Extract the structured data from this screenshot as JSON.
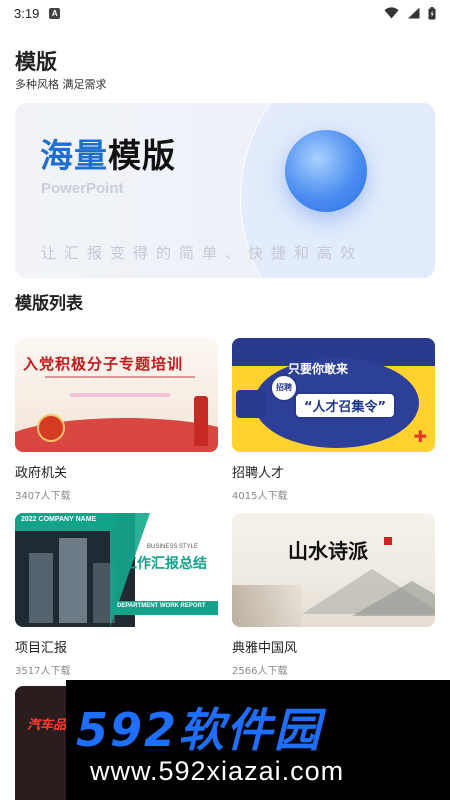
{
  "status_bar": {
    "time": "3:19",
    "notification_icon": "A"
  },
  "header": {
    "title": "模版",
    "subtitle": "多种风格 满足需求"
  },
  "banner": {
    "headline_highlight": "海量",
    "headline_rest": "模版",
    "subtitle_en": "PowerPoint",
    "slogan": "让汇报变得的简单、快捷和高效"
  },
  "section": {
    "title": "模版列表"
  },
  "templates": [
    {
      "name": "政府机关",
      "downloads": "3407人下载",
      "thumb_title": "入党积极分子专题培训"
    },
    {
      "name": "招聘人才",
      "downloads": "4015人下载",
      "thumb_top": "只要你敢来",
      "thumb_badge": "招聘",
      "thumb_title": "“人才召集令”"
    },
    {
      "name": "项目汇报",
      "downloads": "3517人下载",
      "thumb_company": "2022 COMPANY NAME",
      "thumb_style": "BUSINESS STYLE",
      "thumb_title": "工作汇报总结",
      "thumb_footer": "DEPARTMENT WORK REPORT"
    },
    {
      "name": "典雅中国风",
      "downloads": "2566人下载",
      "thumb_title": "山水诗派"
    }
  ],
  "partial_card": {
    "thumb_title": "汽车品"
  },
  "watermark": {
    "brand": "592软件园",
    "url": "www.592xiazai.com"
  },
  "colors": {
    "accent": "#1f6fd1",
    "recruit_yellow": "#ffd22e",
    "report_green": "#13a38a",
    "gov_red": "#c8161d"
  }
}
